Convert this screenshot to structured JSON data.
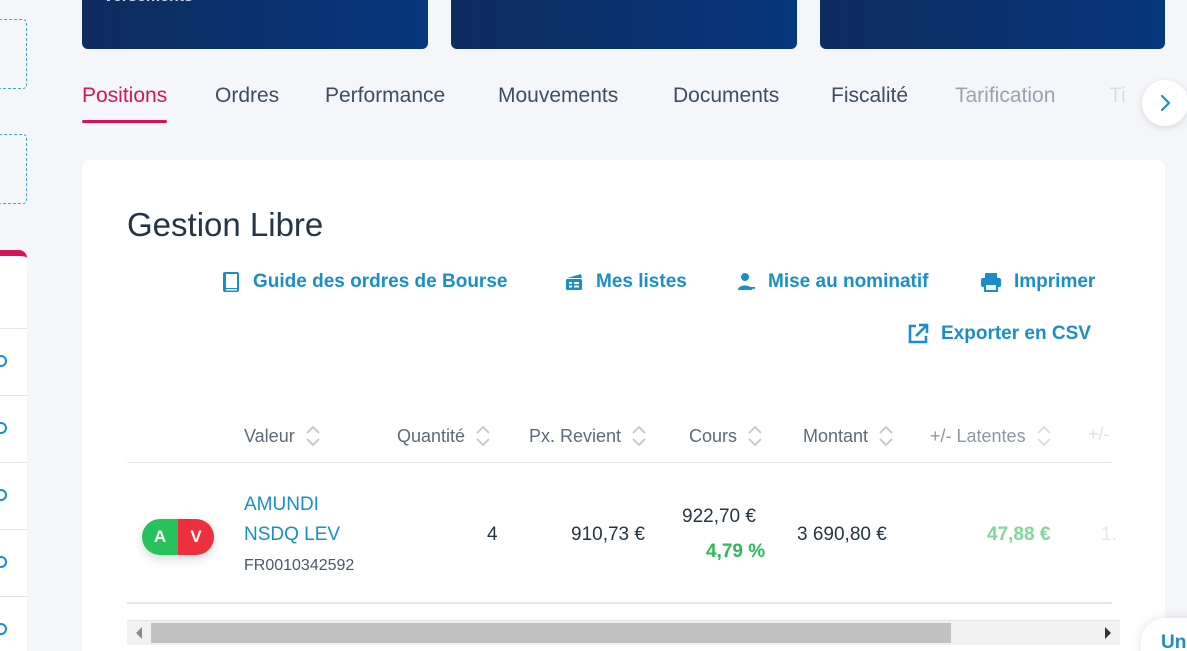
{
  "top_cards": [
    {
      "text": "versements"
    },
    {
      "text": ""
    },
    {
      "text": ""
    }
  ],
  "tabs": [
    {
      "label": "Positions",
      "state": "active"
    },
    {
      "label": "Ordres",
      "state": "normal"
    },
    {
      "label": "Performance",
      "state": "normal"
    },
    {
      "label": "Mouvements",
      "state": "normal"
    },
    {
      "label": "Documents",
      "state": "normal"
    },
    {
      "label": "Fiscalité",
      "state": "normal"
    },
    {
      "label": "Tarification",
      "state": "faded"
    },
    {
      "label": "Ti",
      "state": "faded"
    }
  ],
  "section": {
    "title": "Gestion Libre"
  },
  "actions": {
    "guide": "Guide des ordres de Bourse",
    "lists": "Mes listes",
    "nominatif": "Mise au nominatif",
    "print": "Imprimer",
    "export": "Exporter en CSV"
  },
  "table": {
    "columns": {
      "valeur": "Valeur",
      "quantite": "Quantité",
      "px_revient": "Px. Revient",
      "cours": "Cours",
      "montant": "Montant",
      "latentes": "+/- Latentes",
      "extra": "+/-"
    },
    "rows": [
      {
        "buy": "A",
        "sell": "V",
        "name": "AMUNDI NSDQ LEV",
        "isin": "FR0010342592",
        "quantite": "4",
        "px_revient": "910,73 €",
        "cours": "922,70 €",
        "variation": "4,79 %",
        "montant": "3 690,80 €",
        "latentes": "47,88 €",
        "extra": "1."
      }
    ]
  },
  "chat": {
    "label": "Un"
  },
  "colors": {
    "accent": "#d4145a",
    "link": "#1a8fc5",
    "positive": "#2fb85c",
    "card_bg": "#06367c"
  }
}
